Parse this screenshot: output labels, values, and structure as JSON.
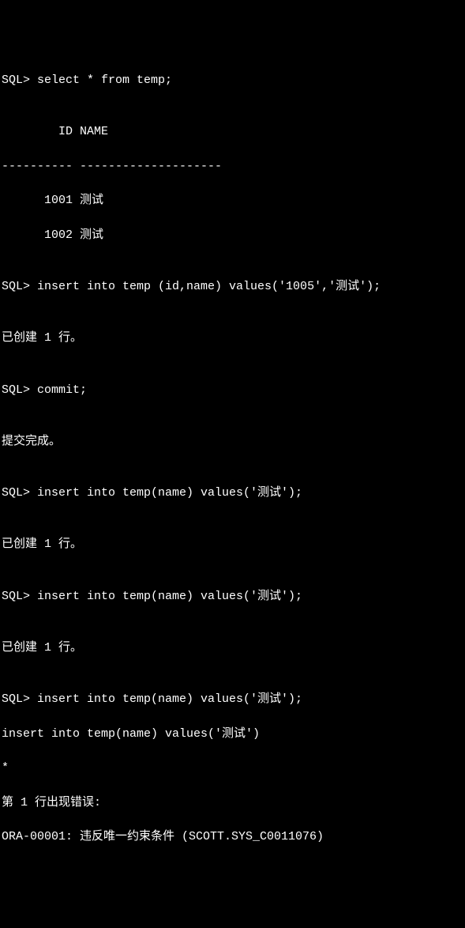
{
  "prompt": "SQL>",
  "lines": {
    "l1": "SQL> select * from temp;",
    "l2": "",
    "l3": "        ID NAME",
    "l4": "---------- --------------------",
    "l5": "      1001 测试",
    "l6": "      1002 测试",
    "l7": "",
    "l8": "SQL> insert into temp (id,name) values('1005','测试');",
    "l9": "",
    "l10": "已创建 1 行。",
    "l11": "",
    "l12": "SQL> commit;",
    "l13": "",
    "l14": "提交完成。",
    "l15": "",
    "l16": "SQL> insert into temp(name) values('测试');",
    "l17": "",
    "l18": "已创建 1 行。",
    "l19": "",
    "l20": "SQL> insert into temp(name) values('测试');",
    "l21": "",
    "l22": "已创建 1 行。",
    "l23": "",
    "l24": "SQL> insert into temp(name) values('测试');",
    "l25": "insert into temp(name) values('测试')",
    "l26": "*",
    "l27": "第 1 行出现错误:",
    "l28": "ORA-00001: 违反唯一约束条件 (SCOTT.SYS_C0011076)"
  }
}
